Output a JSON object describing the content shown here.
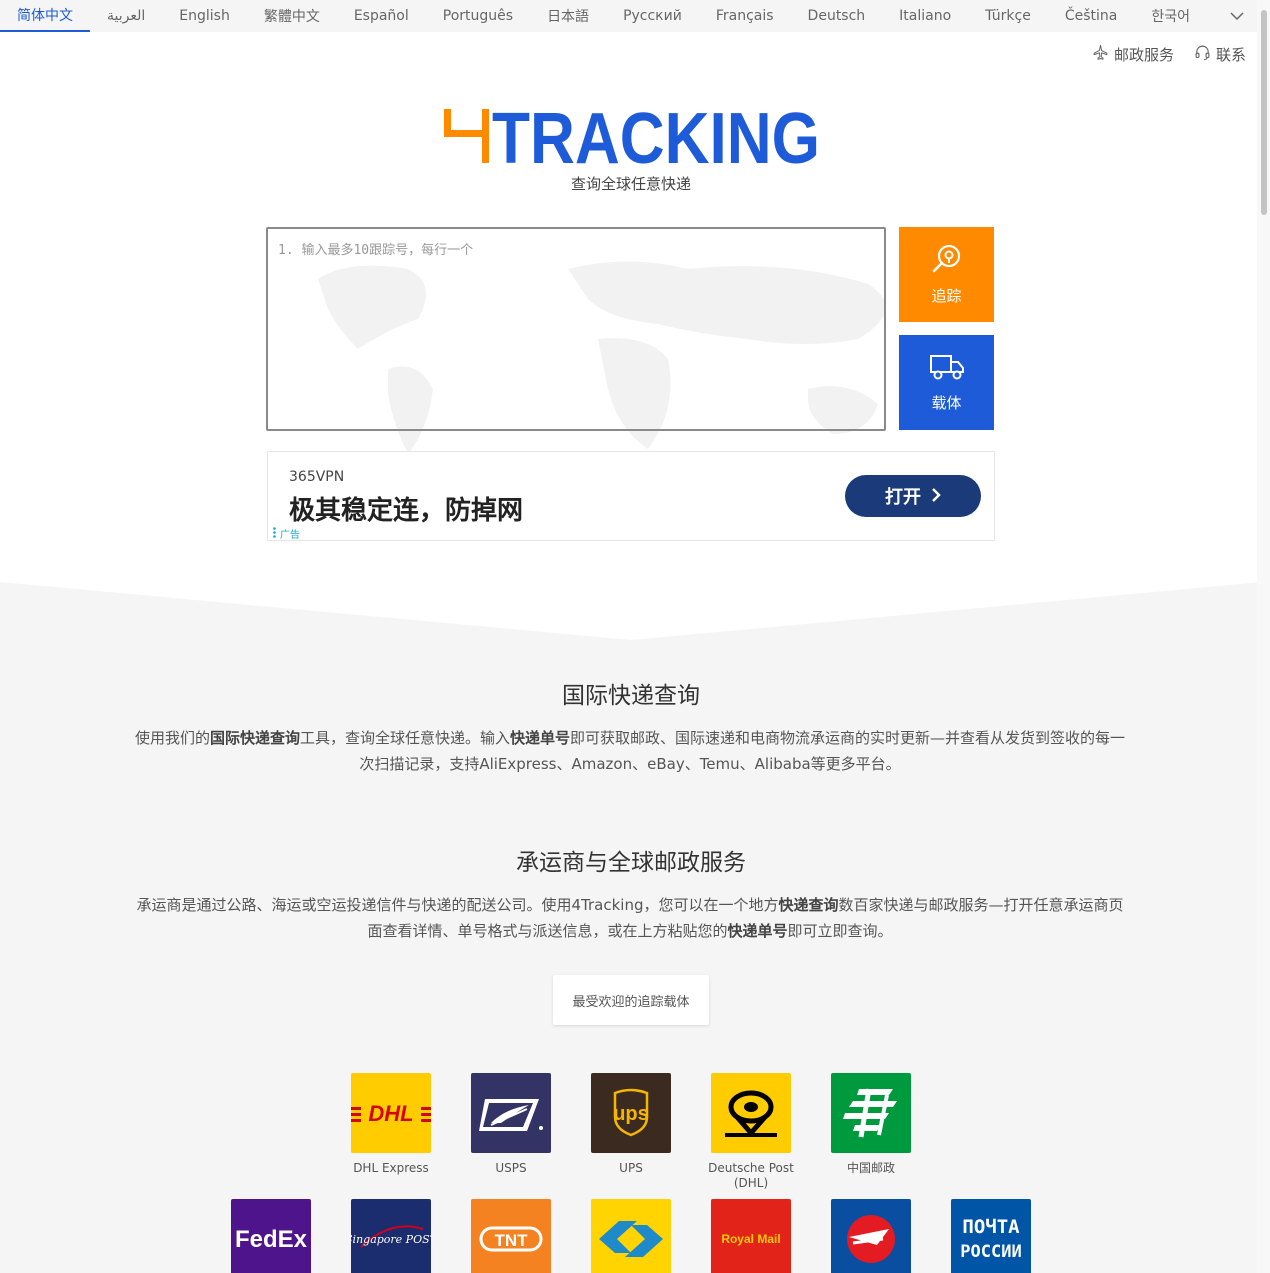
{
  "languages": [
    {
      "label": "简体中文",
      "active": true
    },
    {
      "label": "العربية"
    },
    {
      "label": "English"
    },
    {
      "label": "繁體中文"
    },
    {
      "label": "Español"
    },
    {
      "label": "Português"
    },
    {
      "label": "日本語"
    },
    {
      "label": "Русский"
    },
    {
      "label": "Français"
    },
    {
      "label": "Deutsch"
    },
    {
      "label": "Italiano"
    },
    {
      "label": "Türkçe"
    },
    {
      "label": "Čeština"
    },
    {
      "label": "한국어"
    }
  ],
  "top_links": {
    "postal": "邮政服务",
    "contact": "联系"
  },
  "logo": {
    "prefix": "4",
    "word": "TRACKING",
    "accent": "#ff8a00",
    "brand": "#1e5bd8"
  },
  "tagline": "查询全球任意快递",
  "search": {
    "placeholder": "1. 输入最多10跟踪号，每行一个"
  },
  "buttons": {
    "track": "追踪",
    "carrier": "载体"
  },
  "ad": {
    "brand": "365VPN",
    "headline": "极其稳定连，防掉网",
    "cta": "打开",
    "label": "广告"
  },
  "section1": {
    "title": "国际快递查询",
    "text_a": "使用我们的",
    "bold_a": "国际快递查询",
    "text_b": "工具，查询全球任意快递。输入",
    "bold_b": "快递单号",
    "text_c": "即可获取邮政、国际速递和电商物流承运商的实时更新—并查看从发货到签收的每一次扫描记录，支持AliExpress、Amazon、eBay、Temu、Alibaba等更多平台。"
  },
  "section2": {
    "title": "承运商与全球邮政服务",
    "text_a": "承运商是通过公路、海运或空运投递信件与快递的配送公司。使用4Tracking，您可以在一个地方",
    "bold_a": "快递查询",
    "text_b": "数百家快递与邮政服务—打开任意承运商页面查看详情、单号格式与派送信息，或在上方粘贴您的",
    "bold_b": "快递单号",
    "text_c": "即可立即查询。"
  },
  "popular_button": "最受欢迎的追踪载体",
  "carriers": [
    {
      "name": "DHL Express",
      "logo_text": "DHL"
    },
    {
      "name": "USPS",
      "logo_text": ""
    },
    {
      "name": "UPS",
      "logo_text": "ups"
    },
    {
      "name": "Deutsche Post (DHL)",
      "logo_text": ""
    },
    {
      "name": "中国邮政",
      "logo_text": ""
    },
    {
      "name": "",
      "logo_text": "FedEx"
    },
    {
      "name": "",
      "logo_text": "Singapore POST"
    },
    {
      "name": "",
      "logo_text": "TNT"
    },
    {
      "name": "",
      "logo_text": ""
    },
    {
      "name": "",
      "logo_text": "Royal Mail"
    },
    {
      "name": "",
      "logo_text": ""
    },
    {
      "name": "",
      "logo_text": "ПОЧТА РОССИИ"
    }
  ]
}
